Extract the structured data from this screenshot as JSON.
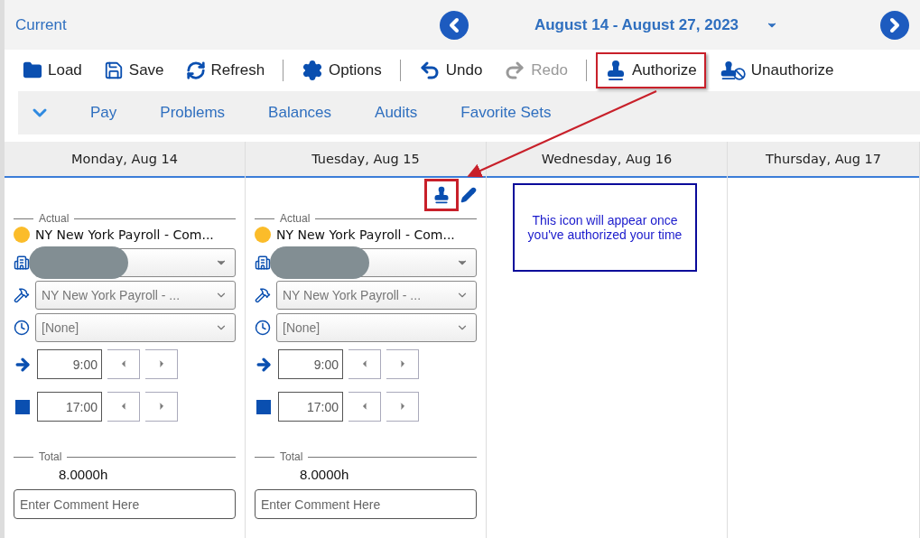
{
  "header": {
    "current": "Current",
    "date_range": "August 14 - August 27, 2023"
  },
  "toolbar": [
    {
      "kind": "load",
      "label": "Load",
      "disabled": false,
      "highlighted": false
    },
    {
      "kind": "save",
      "label": "Save",
      "disabled": false,
      "highlighted": false
    },
    {
      "kind": "refresh",
      "label": "Refresh",
      "disabled": false,
      "highlighted": false
    },
    {
      "kind": "separator"
    },
    {
      "kind": "options",
      "label": "Options",
      "disabled": false,
      "highlighted": false
    },
    {
      "kind": "separator"
    },
    {
      "kind": "undo",
      "label": "Undo",
      "disabled": false,
      "highlighted": false
    },
    {
      "kind": "redo",
      "label": "Redo",
      "disabled": true,
      "highlighted": false
    },
    {
      "kind": "separator"
    },
    {
      "kind": "authorize",
      "label": "Authorize",
      "disabled": false,
      "highlighted": true
    },
    {
      "kind": "unauthorize",
      "label": "Unauthorize",
      "disabled": false,
      "highlighted": false
    }
  ],
  "subnav": {
    "expanded": true,
    "items": [
      "Pay",
      "Problems",
      "Balances",
      "Audits",
      "Favorite Sets"
    ]
  },
  "days": [
    {
      "label": "Monday, Aug 14",
      "entry": {
        "section_label": "Actual",
        "title": "NY New York Payroll - Com...",
        "color": "#fbbc2a",
        "org_redacted": true,
        "job": "NY New York Payroll - ...",
        "shift": "[None]",
        "start": "9:00",
        "end": "17:00",
        "total_label": "Total",
        "total": "8.0000h",
        "comment_placeholder": "Enter Comment Here",
        "authorized": false,
        "highlighted": false,
        "editable": false
      }
    },
    {
      "label": "Tuesday, Aug 15",
      "entry": {
        "section_label": "Actual",
        "title": "NY New York Payroll - Com...",
        "color": "#fbbc2a",
        "org_redacted": true,
        "job": "NY New York Payroll - ...",
        "shift": "[None]",
        "start": "9:00",
        "end": "17:00",
        "total_label": "Total",
        "total": "8.0000h",
        "comment_placeholder": "Enter Comment Here",
        "authorized": true,
        "highlighted": true,
        "editable": true
      }
    },
    {
      "label": "Wednesday, Aug 16",
      "note": "This icon will appear once you've authorized your time"
    },
    {
      "label": "Thursday, Aug 17"
    }
  ]
}
